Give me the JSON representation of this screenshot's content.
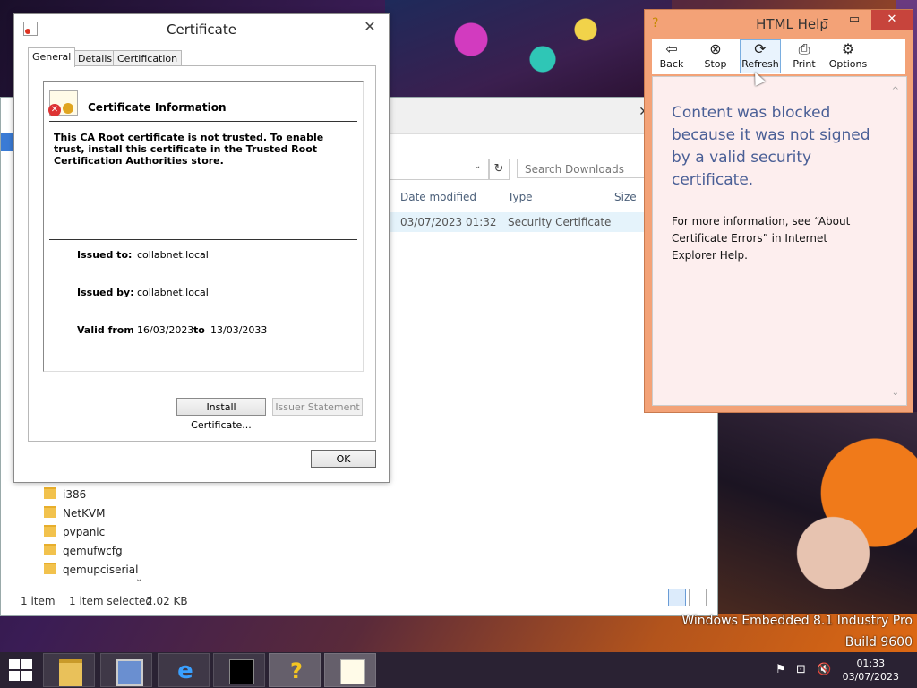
{
  "desktop": {
    "os_name": "Windows Embedded 8.1 Industry Pro",
    "build": "Build 9600"
  },
  "explorer": {
    "search_placeholder": "Search Downloads",
    "columns": [
      "Date modified",
      "Type",
      "Size"
    ],
    "file": {
      "date_modified": "03/07/2023 01:32",
      "type": "Security Certificate"
    },
    "folders": [
      "i386",
      "NetKVM",
      "pvpanic",
      "qemufwcfg",
      "qemupciserial"
    ],
    "status": {
      "count": "1 item",
      "selected": "1 item selected",
      "size": "2.02 KB"
    }
  },
  "certificate": {
    "window_title": "Certificate",
    "tabs": [
      "General",
      "Details",
      "Certification Path"
    ],
    "info_title": "Certificate Information",
    "warning": "This CA Root certificate is not trusted. To enable trust, install this certificate in the Trusted Root Certification Authorities store.",
    "issued_to_label": "Issued to:",
    "issued_to": "collabnet.local",
    "issued_by_label": "Issued by:",
    "issued_by": "collabnet.local",
    "valid_from_label": "Valid from",
    "valid_from": "16/03/2023",
    "to_label": "to",
    "valid_to": "13/03/2033",
    "install_button": "Install Certificate...",
    "issuer_statement_button": "Issuer Statement",
    "ok_button": "OK"
  },
  "help": {
    "window_title": "HTML Help",
    "toolbar": [
      "Back",
      "Stop",
      "Refresh",
      "Print",
      "Options"
    ],
    "blocked_message": "Content was blocked because it was not signed by a valid security certificate.",
    "more_info": "For more information, see “About Certificate Errors” in Internet Explorer Help."
  },
  "taskbar": {
    "time": "01:33",
    "date": "03/07/2023"
  },
  "colors": {
    "help_frame": "#f3a277",
    "help_content_bg": "#fdeeee",
    "help_heading": "#4a5f96",
    "taskbar": "#2a2233"
  }
}
